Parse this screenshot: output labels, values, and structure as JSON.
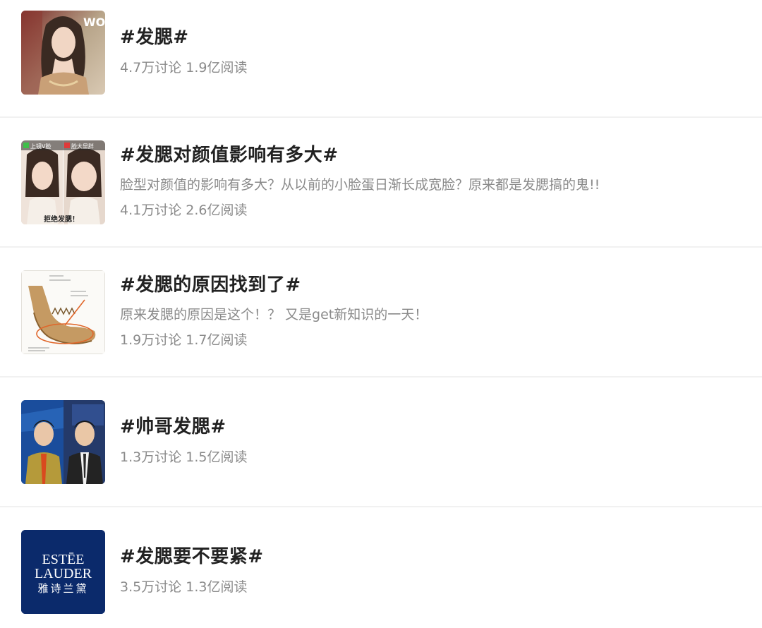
{
  "topics": [
    {
      "title": "#发腮#",
      "description": "",
      "stats": "4.7万讨论 1.9亿阅读",
      "thumb": "red-carpet-photo",
      "thumb_text": "WO"
    },
    {
      "title": "#发腮对颜值影响有多大#",
      "description": "脸型对颜值的影响有多大？从以前的小脸蛋日渐长成宽脸？原来都是发腮搞的鬼!!",
      "stats": "4.1万讨论 2.6亿阅读",
      "thumb": "face-comparison-photo",
      "thumb_text_left": "上镜V脸",
      "thumb_text_right": "脸大显胖",
      "thumb_caption": "拒绝发腮！"
    },
    {
      "title": "#发腮的原因找到了#",
      "description": "原来发腮的原因是这个！？ 又是get新知识的一天！",
      "stats": "1.9万讨论 1.7亿阅读",
      "thumb": "jaw-anatomy-diagram"
    },
    {
      "title": "#帅哥发腮#",
      "description": "",
      "stats": "1.3万讨论 1.5亿阅读",
      "thumb": "news-anchors-photo"
    },
    {
      "title": "#发腮要不要紧#",
      "description": "",
      "stats": "3.5万讨论 1.3亿阅读",
      "thumb": "estee-lauder-logo",
      "logo_line1": "ESTĒE",
      "logo_line2": "LAUDER",
      "logo_line3": "雅诗兰黛"
    }
  ],
  "colors": {
    "title": "#222222",
    "meta": "#8a8a8a",
    "divider": "#f1f1f1",
    "estee_navy": "#0b2a6b"
  }
}
